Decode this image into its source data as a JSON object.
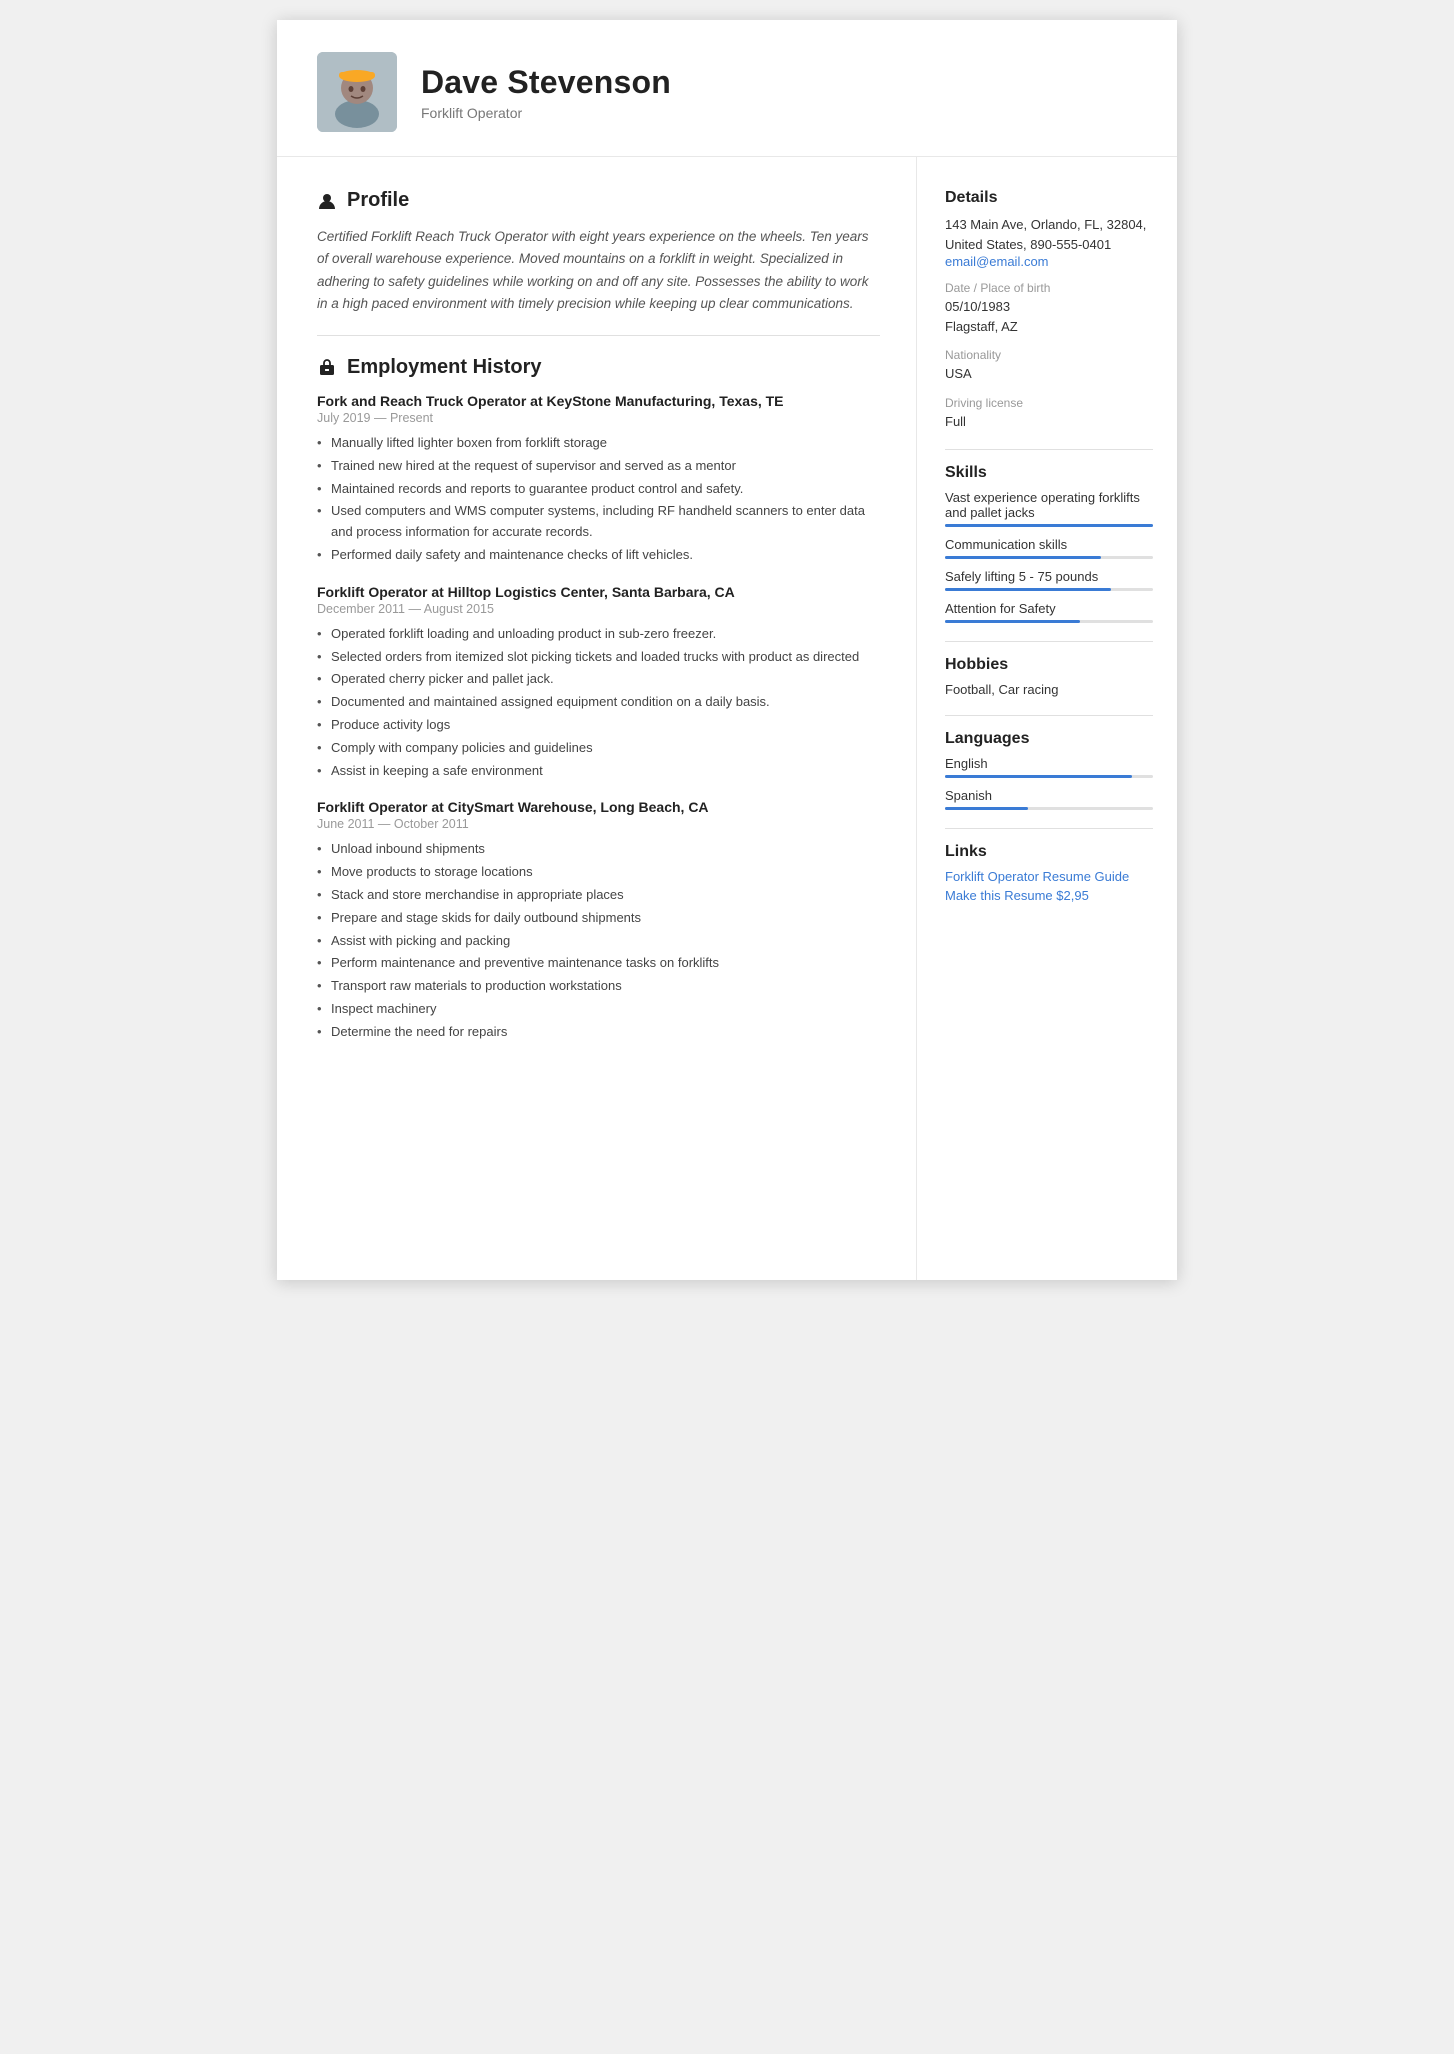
{
  "header": {
    "name": "Dave Stevenson",
    "subtitle": "Forklift Operator"
  },
  "profile": {
    "section_label": "Profile",
    "text": "Certified Forklift Reach Truck Operator with eight years experience on the wheels. Ten years of overall warehouse experience. Moved mountains on a forklift in weight. Specialized in adhering to safety guidelines while working on and off any site. Possesses the ability to work in a high paced environment with timely precision while keeping up clear communications."
  },
  "employment": {
    "section_label": "Employment History",
    "jobs": [
      {
        "title": "Fork and Reach Truck Operator at  KeyStone Manufacturing, Texas, TE",
        "date": "July 2019 — Present",
        "bullets": [
          "Manually lifted lighter boxen from forklift storage",
          "Trained new hired at the request of supervisor and served as a mentor",
          "Maintained records and reports to guarantee product control and safety.",
          "Used computers and WMS computer systems, including RF handheld scanners to enter data and process information for accurate records.",
          "Performed daily safety and maintenance checks of lift vehicles."
        ]
      },
      {
        "title": "Forklift Operator at  Hilltop Logistics Center, Santa Barbara, CA",
        "date": "December 2011 — August 2015",
        "bullets": [
          "Operated forklift loading and unloading product in sub-zero freezer.",
          "Selected orders from itemized slot picking tickets and loaded trucks with product as directed",
          "Operated cherry picker and pallet jack.",
          "Documented and maintained assigned equipment condition on a daily basis.",
          "Produce activity logs",
          "Comply with company policies and guidelines",
          "Assist in keeping a safe environment"
        ]
      },
      {
        "title": "Forklift Operator at  CitySmart Warehouse, Long Beach, CA",
        "date": "June 2011 — October 2011",
        "bullets": [
          "Unload inbound shipments",
          "Move products to storage locations",
          "Stack and store merchandise in appropriate places",
          "Prepare and stage skids for daily outbound shipments",
          "Assist with picking and packing",
          "Perform maintenance and preventive maintenance tasks on forklifts",
          "Transport raw materials to production workstations",
          "Inspect machinery",
          "Determine the need for repairs"
        ]
      }
    ]
  },
  "sidebar": {
    "details": {
      "section_label": "Details",
      "address": "143 Main Ave, Orlando, FL, 32804, United States, 890-555-0401",
      "email": "email@email.com",
      "dob_label": "Date / Place of birth",
      "dob_value": "05/10/1983",
      "dob_place": "Flagstaff, AZ",
      "nationality_label": "Nationality",
      "nationality_value": "USA",
      "driving_label": "Driving license",
      "driving_value": "Full"
    },
    "skills": {
      "section_label": "Skills",
      "items": [
        {
          "name": "Vast experience operating forklifts and pallet jacks",
          "fill_pct": 100
        },
        {
          "name": "Communication skills",
          "fill_pct": 75
        },
        {
          "name": "Safely lifting 5 - 75 pounds",
          "fill_pct": 80
        },
        {
          "name": "Attention for Safety",
          "fill_pct": 65
        }
      ]
    },
    "hobbies": {
      "section_label": "Hobbies",
      "text": "Football, Car racing"
    },
    "languages": {
      "section_label": "Languages",
      "items": [
        {
          "name": "English",
          "fill_pct": 90
        },
        {
          "name": "Spanish",
          "fill_pct": 40
        }
      ]
    },
    "links": {
      "section_label": "Links",
      "items": [
        {
          "label": "Forklift Operator Resume Guide"
        },
        {
          "label": "Make this Resume $2,95"
        }
      ]
    }
  }
}
